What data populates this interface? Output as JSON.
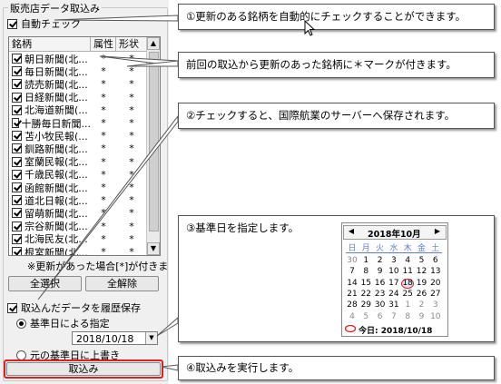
{
  "panel": {
    "group_title": "販売店データ取込み",
    "auto_check_label": "自動チェック",
    "columns": [
      "銘柄",
      "属性",
      "形状"
    ],
    "rows": [
      {
        "name": "朝日新聞(北...",
        "attr": "*",
        "shape": "*"
      },
      {
        "name": "毎日新聞(北...",
        "attr": "*",
        "shape": "*"
      },
      {
        "name": "読売新聞(北...",
        "attr": "*",
        "shape": "*"
      },
      {
        "name": "日経新聞(北...",
        "attr": "*",
        "shape": "*"
      },
      {
        "name": "北海道新聞(...",
        "attr": "*",
        "shape": "*"
      },
      {
        "name": "十勝毎日新聞...",
        "attr": "*",
        "shape": "*"
      },
      {
        "name": "苫小牧民報(...",
        "attr": "*",
        "shape": "*"
      },
      {
        "name": "釧路新聞(北...",
        "attr": "*",
        "shape": "*"
      },
      {
        "name": "室蘭民報(北...",
        "attr": "*",
        "shape": "*"
      },
      {
        "name": "千歳民報(北...",
        "attr": "*",
        "shape": "*"
      },
      {
        "name": "函館新聞(北...",
        "attr": "*",
        "shape": "*"
      },
      {
        "name": "道北日報(北...",
        "attr": "*",
        "shape": "*"
      },
      {
        "name": "留萌新聞(北...",
        "attr": "*",
        "shape": "*"
      },
      {
        "name": "宗谷新聞(北...",
        "attr": "*",
        "shape": "*"
      },
      {
        "name": "北海民友(北...",
        "attr": "*",
        "shape": "*"
      },
      {
        "name": "根室新聞(北...",
        "attr": "*",
        "shape": "*"
      }
    ],
    "note": "※更新があった場合[*]が付きます",
    "select_all": "全選択",
    "clear_all": "全解除",
    "save_history_label": "取込んだデータを履歴保存",
    "radio_base_date": "基準日による指定",
    "date_value": "2018/10/18",
    "radio_overwrite": "元の基準日に上書き",
    "import_button": "取込み"
  },
  "callouts": {
    "c1": "①更新のある銘柄を自動的にチェックすることができます。",
    "c2": "前回の取込から更新のあった銘柄に＊マークが付きます。",
    "c3": "②チェックすると、国際航業のサーバーへ保存されます。",
    "c4": "③基準日を指定します。",
    "c5": "④取込みを実行します。"
  },
  "calendar": {
    "title": "2018年10月",
    "prev": "◀",
    "next": "▶",
    "weekdays": [
      "日",
      "月",
      "火",
      "水",
      "木",
      "金",
      "土"
    ],
    "weeks": [
      [
        "30",
        "1",
        "2",
        "3",
        "4",
        "5",
        "6"
      ],
      [
        "7",
        "8",
        "9",
        "10",
        "11",
        "12",
        "13"
      ],
      [
        "14",
        "15",
        "16",
        "17",
        "18",
        "19",
        "20"
      ],
      [
        "21",
        "22",
        "23",
        "24",
        "25",
        "26",
        "27"
      ],
      [
        "28",
        "29",
        "30",
        "31",
        "1",
        "2",
        "3"
      ],
      [
        "4",
        "5",
        "6",
        "7",
        "8",
        "9",
        "10"
      ]
    ],
    "today_label": "今日: 2018/10/18"
  },
  "colors": {
    "highlight": "#e0201f",
    "calendar_header": "#5f7fc8"
  }
}
